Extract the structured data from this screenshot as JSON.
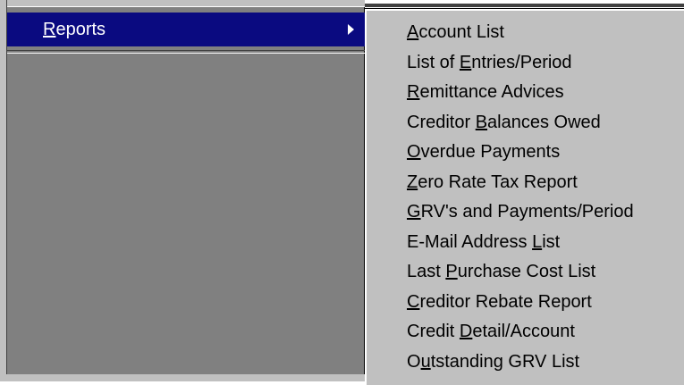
{
  "parent_menu": {
    "highlighted_item": {
      "label": "Reports",
      "mnemonic_index": 0,
      "icon": "submenu-arrow-icon"
    }
  },
  "submenu": {
    "items": [
      {
        "label": "Account List",
        "mnemonic_index": 0
      },
      {
        "label": "List of Entries/Period",
        "mnemonic_index": 8
      },
      {
        "label": "Remittance Advices",
        "mnemonic_index": 0
      },
      {
        "label": "Creditor Balances Owed",
        "mnemonic_index": 9
      },
      {
        "label": "Overdue Payments",
        "mnemonic_index": 0
      },
      {
        "label": "Zero Rate Tax Report",
        "mnemonic_index": 0
      },
      {
        "label": "GRV's and Payments/Period",
        "mnemonic_index": 0
      },
      {
        "label": "E-Mail Address List",
        "mnemonic_index": 15
      },
      {
        "label": "Last Purchase Cost List",
        "mnemonic_index": 5
      },
      {
        "label": "Creditor Rebate Report",
        "mnemonic_index": 0
      },
      {
        "label": "Credit Detail/Account",
        "mnemonic_index": 7
      },
      {
        "label": "Outstanding GRV List",
        "mnemonic_index": 1
      }
    ]
  },
  "colors": {
    "highlight_bg": "#0a0a80",
    "menu_bg": "#c0c0c0",
    "parent_bg": "#808080"
  }
}
